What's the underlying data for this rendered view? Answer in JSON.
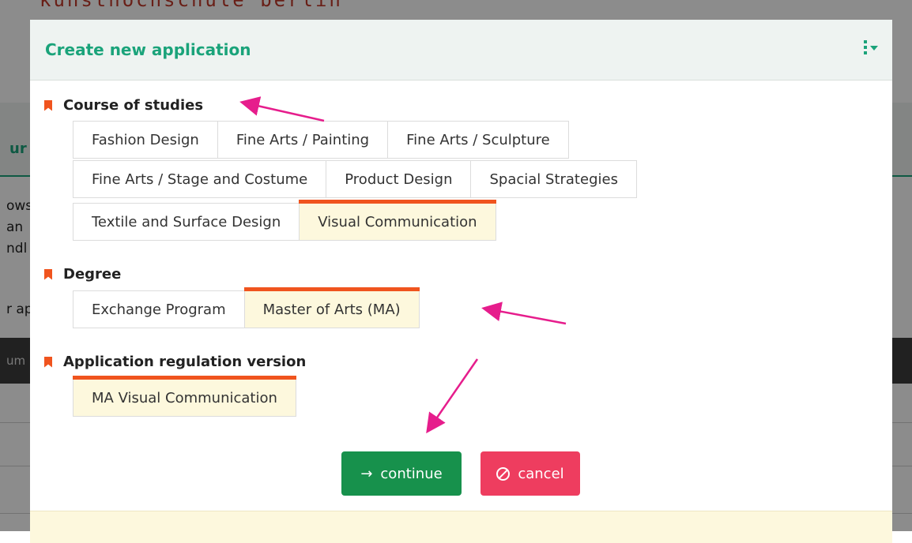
{
  "background": {
    "logo": "kunsthochschule berlin",
    "tab_fragment": "ur",
    "text_fragments": [
      "ows",
      "an",
      "ndl"
    ],
    "text_fragment_5": "r ap",
    "bar_fragment": "um"
  },
  "modal": {
    "title": "Create new application",
    "menu_icon": "vertical-dots-icon",
    "sections": {
      "course": {
        "label": "Course of studies",
        "rows": [
          [
            "Fashion Design",
            "Fine Arts / Painting",
            "Fine Arts / Sculpture"
          ],
          [
            "Fine Arts / Stage and Costume",
            "Product Design",
            "Spacial Strategies"
          ],
          [
            "Textile and Surface Design",
            "Visual Communication"
          ]
        ],
        "selected": "Visual Communication"
      },
      "degree": {
        "label": "Degree",
        "options": [
          "Exchange Program",
          "Master of Arts (MA)"
        ],
        "selected": "Master of Arts (MA)"
      },
      "regulation": {
        "label": "Application regulation version",
        "options": [
          "MA Visual Communication"
        ],
        "selected": "MA Visual Communication"
      }
    },
    "buttons": {
      "continue": {
        "icon": "→",
        "label": "continue"
      },
      "cancel": {
        "icon": "cancel-circle-icon",
        "label": "cancel"
      }
    }
  },
  "colors": {
    "accent": "#1aa37a",
    "selected_bar": "#f0541e",
    "continue": "#17914c",
    "cancel": "#ee3d5f",
    "annotation_arrow": "#e61d8c"
  }
}
